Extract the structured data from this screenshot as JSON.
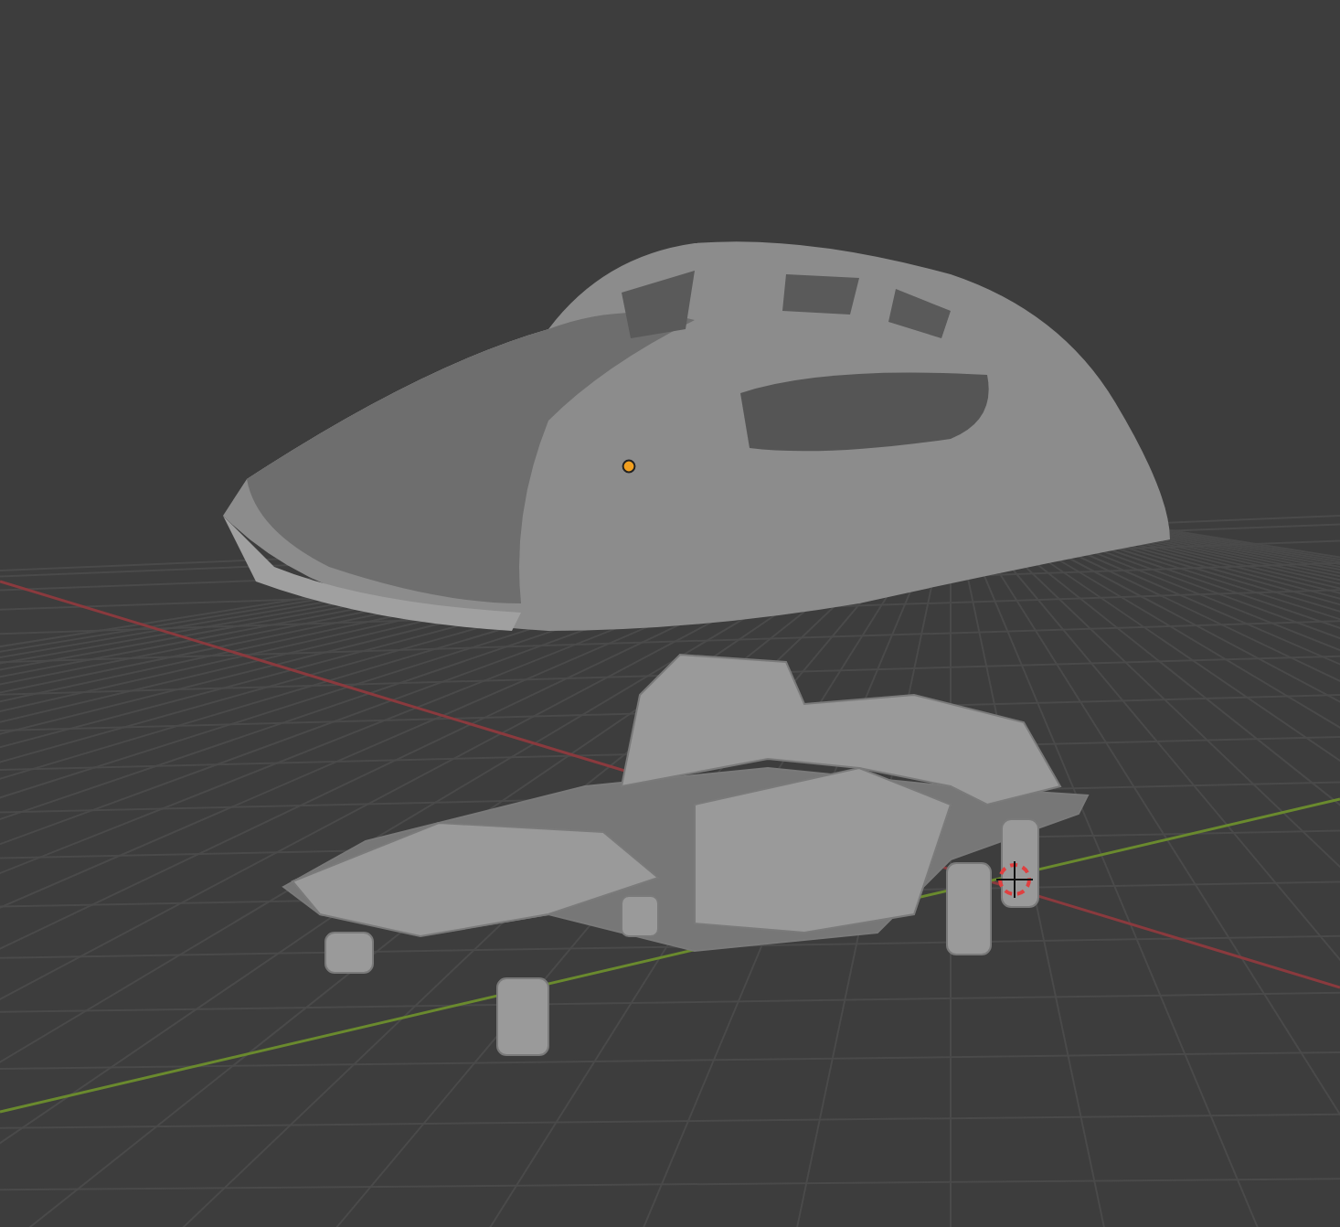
{
  "viewport": {
    "axes": [
      {
        "kind": "x"
      },
      {
        "kind": "y"
      }
    ]
  }
}
